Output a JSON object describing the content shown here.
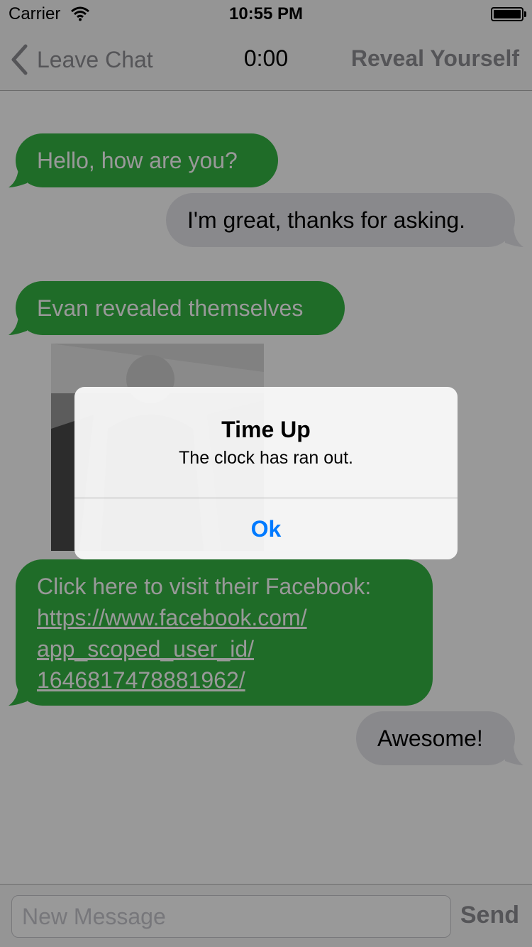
{
  "status_bar": {
    "carrier": "Carrier",
    "time": "10:55 PM"
  },
  "nav": {
    "back_label": "Leave Chat",
    "timer": "0:00",
    "reveal_label": "Reveal Yourself"
  },
  "messages": [
    {
      "side": "in",
      "text": "Hello, how are you?"
    },
    {
      "side": "out",
      "text": "I'm great, thanks for asking."
    },
    {
      "side": "in",
      "text": "Evan revealed themselves"
    },
    {
      "side": "in",
      "text": "Click here to visit their Facebook:",
      "link": "https://www.facebook.com/ app_scoped_user_id/ 1646817478881962/"
    },
    {
      "side": "out",
      "text": "Awesome!"
    }
  ],
  "input": {
    "placeholder": "New Message",
    "send_label": "Send"
  },
  "alert": {
    "title": "Time Up",
    "message": "The clock has ran out.",
    "button": "Ok"
  },
  "colors": {
    "incoming": "#34b443",
    "outgoing": "#e5e5ea",
    "accent": "#007aff"
  }
}
